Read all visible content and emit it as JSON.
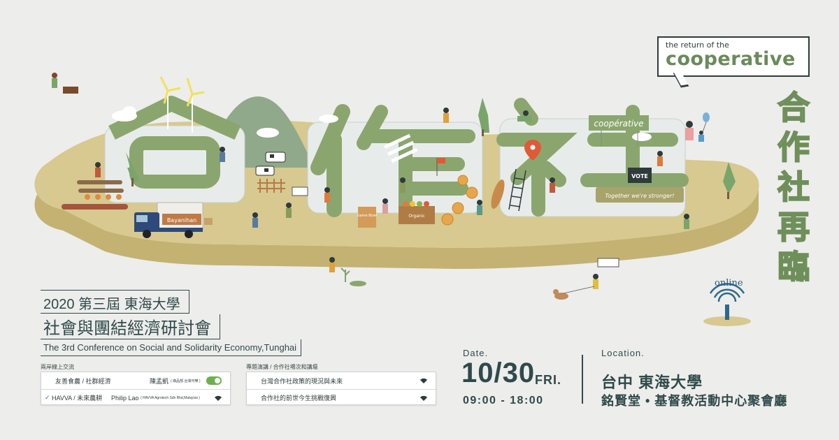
{
  "header": {
    "bubble_small": "the return of the",
    "bubble_big": "cooperative",
    "vertical_title": [
      "合",
      "作",
      "社",
      "再",
      "臨"
    ]
  },
  "illustration": {
    "truck_label": "Bayanihan",
    "billboard_label": "coopérative",
    "vote_label": "VOTE",
    "banner_label": "Together we're stronger!",
    "sign_1": "Game Bowl",
    "sign_2": "Organic",
    "online_label": "online"
  },
  "event": {
    "year_line": "2020 第三屆 東海大學",
    "title_zh": "社會與團結經濟研討會",
    "title_en": "The 3rd Conference on Social and Solidarity Economy,Tunghai"
  },
  "panel_left": {
    "title": "兩岸線上交流",
    "rows": [
      {
        "check": "",
        "col1": "友善食農 / 社群經濟",
        "col2": "陳孟凱",
        "col3": "( 綠品部.台灣可樂 )"
      },
      {
        "check": "✓",
        "col1": "HAVVA / 未來農耕",
        "col2": "Philip Lao",
        "col3": "( HAVVA Agrotech Sdn Bhd,Malaysia )"
      }
    ]
  },
  "panel_right": {
    "title": "專題演講 / 合作社場次和講壇",
    "rows": [
      {
        "label": "台灣合作社政策的現況與未來"
      },
      {
        "label": "合作社的前世今生挑戰復興"
      }
    ]
  },
  "date": {
    "label": "Date.",
    "day": "10/30",
    "weekday": "FRI.",
    "time": "09:00 - 18:00"
  },
  "location": {
    "label": "Location.",
    "line1": "台中 東海大學",
    "line2": "銘賢堂 • 基督教活動中心聚會廳"
  },
  "colors": {
    "background": "#ededec",
    "island_top": "#d7c98f",
    "island_side": "#c3b272",
    "green": "#7d9b6a",
    "building": "#e7eceb",
    "text_dark": "#2f4a4a",
    "toggle_on": "#6ab04c"
  },
  "icons": [
    "wifi-icon",
    "toggle-icon",
    "check-icon",
    "wind-turbine-icon",
    "location-pin-icon",
    "tree-icon",
    "cow-icon",
    "truck-icon",
    "broadcast-icon"
  ]
}
